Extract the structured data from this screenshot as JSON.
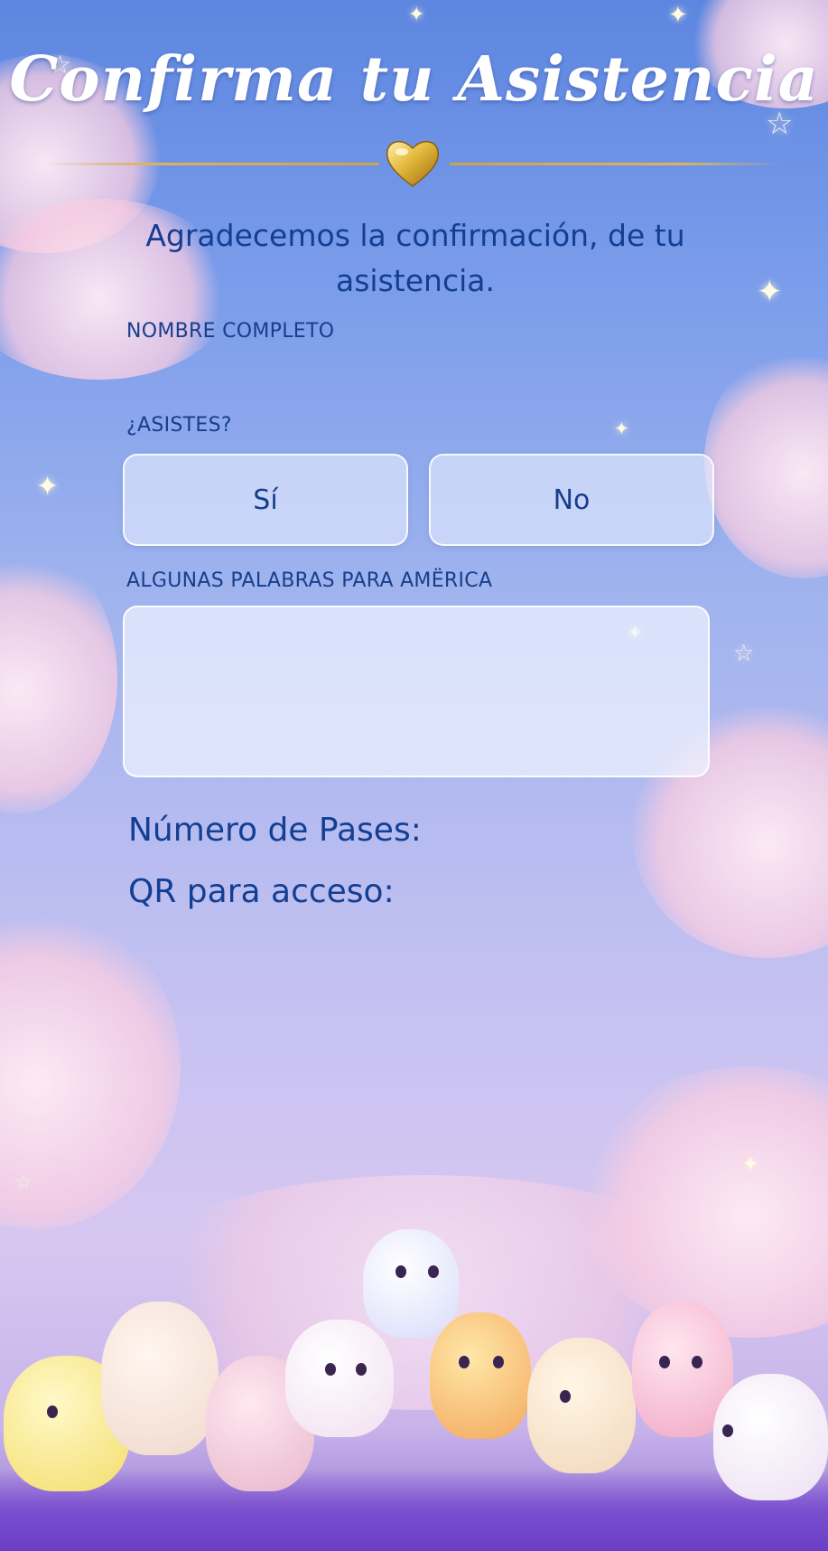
{
  "header": {
    "title": "Confirma tu Asistencia",
    "subtitle": "Agradecemos la confirmación, de tu asistencia."
  },
  "form": {
    "name_label": "NOMBRE COMPLETO",
    "name_value": "",
    "attend_label": "¿ASISTES?",
    "attend_yes": "Sí",
    "attend_no": "No",
    "message_label": "ALGUNAS PALABRAS PARA AMËRICA",
    "message_value": ""
  },
  "info": {
    "passes_label": "Número de Pases:",
    "qr_label": "QR para acceso:"
  },
  "icons": {
    "divider_icon": "heart-icon",
    "decoration": "star-icon"
  },
  "colors": {
    "text_primary": "#133f93",
    "accent_gold": "#d9b65c"
  }
}
